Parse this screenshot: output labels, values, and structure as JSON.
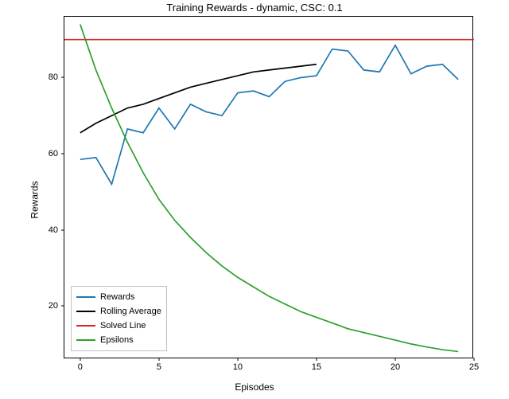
{
  "chart_data": {
    "type": "line",
    "title": "Training Rewards - dynamic, CSC: 0.1",
    "xlabel": "Episodes",
    "ylabel": "Rewards",
    "xlim": [
      -1,
      25
    ],
    "ylim": [
      6,
      96
    ],
    "xticks": [
      0,
      5,
      10,
      15,
      20,
      25
    ],
    "yticks": [
      20,
      40,
      60,
      80
    ],
    "series": [
      {
        "name": "Rewards",
        "color": "#1f77b4",
        "x": [
          0,
          1,
          2,
          3,
          4,
          5,
          6,
          7,
          8,
          9,
          10,
          11,
          12,
          13,
          14,
          15,
          16,
          17,
          18,
          19,
          20,
          21,
          22,
          23,
          24
        ],
        "y": [
          58.5,
          59,
          52,
          66.5,
          65.5,
          72,
          66.5,
          73,
          71,
          70,
          76,
          76.5,
          75,
          79,
          80,
          80.5,
          87.5,
          87,
          82,
          81.5,
          88.5,
          81,
          83,
          83.5,
          79.5
        ]
      },
      {
        "name": "Rolling Average",
        "color": "#000000",
        "x": [
          0,
          1,
          2,
          3,
          4,
          5,
          6,
          7,
          8,
          9,
          10,
          11,
          12,
          13,
          14,
          15
        ],
        "y": [
          65.5,
          68,
          70,
          72,
          73,
          74.5,
          76,
          77.5,
          78.5,
          79.5,
          80.5,
          81.5,
          82,
          82.5,
          83,
          83.5
        ]
      },
      {
        "name": "Solved Line",
        "color": "#d62728",
        "x": [
          -1,
          25
        ],
        "y": [
          90,
          90
        ]
      },
      {
        "name": "Epsilons",
        "color": "#2ca02c",
        "x": [
          0,
          1,
          2,
          3,
          4,
          5,
          6,
          7,
          8,
          9,
          10,
          11,
          12,
          13,
          14,
          15,
          16,
          17,
          18,
          19,
          20,
          21,
          22,
          23,
          24
        ],
        "y": [
          94,
          82,
          72,
          63,
          55,
          48,
          42.5,
          38,
          34,
          30.5,
          27.5,
          25,
          22.5,
          20.5,
          18.5,
          17,
          15.5,
          14,
          13,
          12,
          11,
          10,
          9.2,
          8.5,
          8
        ]
      }
    ],
    "legend": {
      "items": [
        "Rewards",
        "Rolling Average",
        "Solved Line",
        "Epsilons"
      ]
    }
  }
}
